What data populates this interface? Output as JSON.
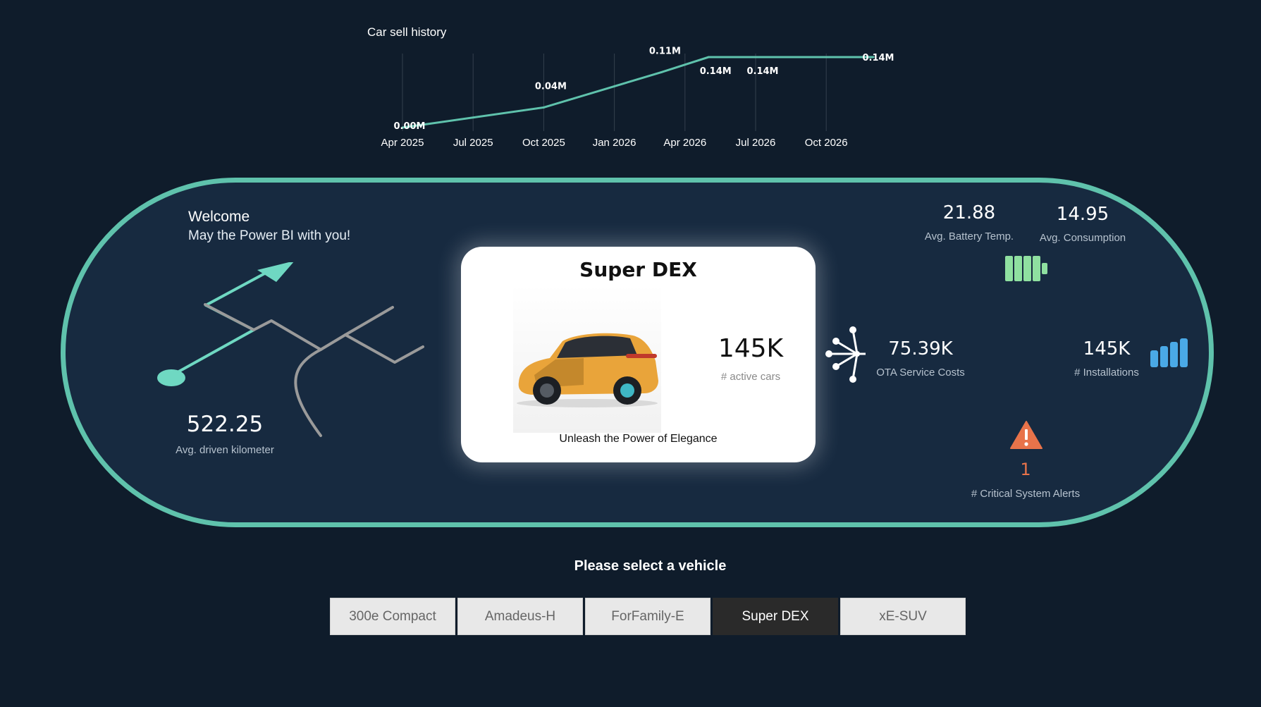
{
  "chart": {
    "title": "Car sell history"
  },
  "chart_data": {
    "type": "line",
    "title": "Car sell history",
    "xlabel": "",
    "ylabel": "",
    "x": [
      "Apr 2025",
      "Oct 2025",
      "Mar 2026",
      "May 2026",
      "Jul 2026",
      "Dec 2026"
    ],
    "y": [
      0.0,
      0.04,
      0.11,
      0.14,
      0.14,
      0.14
    ],
    "data_labels": [
      "0.00M",
      "0.04M",
      "0.11M",
      "0.14M",
      "0.14M",
      "0.14M"
    ],
    "x_ticks": [
      "Apr 2025",
      "Jul 2025",
      "Oct 2025",
      "Jan 2026",
      "Apr 2026",
      "Jul 2026",
      "Oct 2026"
    ],
    "unit": "M",
    "grid": "vertical",
    "color": "#5fc2ac"
  },
  "welcome": {
    "title": "Welcome",
    "subtitle": "May the Power BI with you!"
  },
  "kpis": {
    "avg_km": {
      "value": "522.25",
      "label": "Avg. driven kilometer"
    },
    "battery_temp": {
      "value": "21.88",
      "label": "Avg. Battery Temp."
    },
    "consumption": {
      "value": "14.95",
      "label": "Avg. Consumption"
    },
    "ota_costs": {
      "value": "75.39K",
      "label": "OTA Service Costs"
    },
    "installations": {
      "value": "145K",
      "label": "# Installations"
    },
    "alerts": {
      "value": "1",
      "label": "# Critical System Alerts"
    }
  },
  "card": {
    "title": "Super DEX",
    "active_value": "145K",
    "active_label": "# active cars",
    "tagline": "Unleash the Power of Elegance"
  },
  "selector": {
    "title": "Please select a vehicle",
    "options": [
      "300e Compact",
      "Amadeus-H",
      "ForFamily-E",
      "Super DEX",
      "xE-SUV"
    ],
    "selected": "Super DEX"
  },
  "icons": {
    "route": "route-map-icon",
    "battery": "battery-icon",
    "network": "network-hub-icon",
    "bars": "signal-bars-icon",
    "warning": "warning-icon",
    "car": "car-image"
  },
  "colors": {
    "accent": "#5fc2ac",
    "background": "#0f1c2b",
    "panel": "#172a40",
    "alert": "#e8734a",
    "battery": "#8fe0a0",
    "bars": "#4aa9e6"
  }
}
